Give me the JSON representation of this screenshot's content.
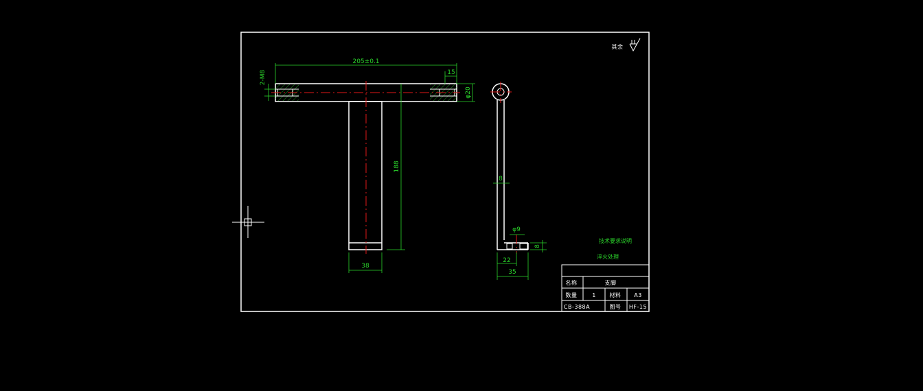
{
  "drawing": {
    "dimensions": {
      "top_width": "205±0.1",
      "hole_callout": "2-M8",
      "chamfer": "15",
      "rod_diameter": "φ20",
      "leg_length": "188",
      "leg_width": "38",
      "side_thickness": "8",
      "side_hole": "φ9",
      "side_foot_height": "8",
      "side_inner": "22",
      "side_total": "35"
    },
    "roughness_note": "其余",
    "notes": {
      "tech_requirement": "技术要求说明",
      "heat_treatment": "淬火处理"
    },
    "title_block": {
      "name_label": "名称",
      "name_value": "支脚",
      "qty_label": "数量",
      "qty_value": "1",
      "material_label": "材料",
      "material_value": "A3",
      "standard": "CB-388A",
      "drawing_no_label": "图号",
      "drawing_no_value": "HF-15"
    }
  },
  "colors": {
    "background": "#000000",
    "outline": "#ffffff",
    "dimension": "#2bd62b",
    "centerline": "#e01818"
  }
}
